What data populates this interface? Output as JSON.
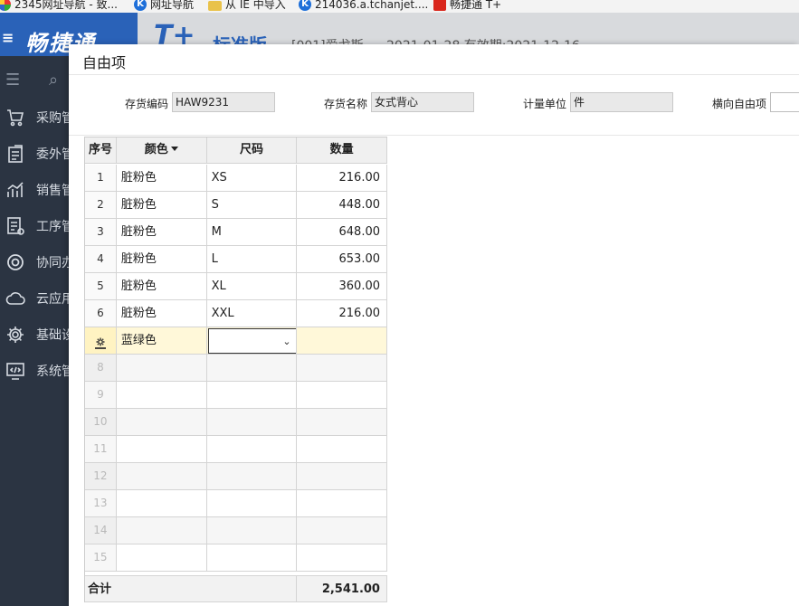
{
  "bookmarks": [
    {
      "label": "2345网址导航 - 致...",
      "icon": "multicolor-icon"
    },
    {
      "label": "网址导航",
      "icon": "k-icon"
    },
    {
      "label": "从 IE 中导入",
      "icon": "folder-icon"
    },
    {
      "label": "214036.a.tchanjet....",
      "icon": "k-icon"
    },
    {
      "label": "畅捷通 T+",
      "icon": "pdf-icon"
    }
  ],
  "header": {
    "logo": "畅捷通",
    "product": "T+",
    "edition": "标准版",
    "company": "[001]爱戈斯",
    "period": "2021-01-28   有效期:2021-12-16"
  },
  "sidebar": {
    "items": [
      {
        "label": "采购管理",
        "icon": "cart-icon"
      },
      {
        "label": "委外管理",
        "icon": "outsource-icon"
      },
      {
        "label": "销售管理",
        "icon": "sales-chart-icon"
      },
      {
        "label": "工序管理",
        "icon": "process-doc-icon"
      },
      {
        "label": "协同办公",
        "icon": "collab-icon"
      },
      {
        "label": "云应用",
        "icon": "cloud-icon"
      },
      {
        "label": "基础设置",
        "icon": "settings-icon"
      },
      {
        "label": "系统管理",
        "icon": "system-code-icon"
      }
    ]
  },
  "dialog": {
    "title": "自由项",
    "fields": {
      "code_label": "存货编码",
      "code_value": "HAW9231",
      "name_label": "存货名称",
      "name_value": "女式背心",
      "unit_label": "计量单位",
      "unit_value": "件",
      "horizontal_label": "横向自由项",
      "horizontal_value": ""
    },
    "grid": {
      "headers": [
        "序号",
        "颜色",
        "尺码",
        "数量"
      ],
      "rows": [
        {
          "no": "1",
          "color": "脏粉色",
          "size": "XS",
          "qty": "216.00"
        },
        {
          "no": "2",
          "color": "脏粉色",
          "size": "S",
          "qty": "448.00"
        },
        {
          "no": "3",
          "color": "脏粉色",
          "size": "M",
          "qty": "648.00"
        },
        {
          "no": "4",
          "color": "脏粉色",
          "size": "L",
          "qty": "653.00"
        },
        {
          "no": "5",
          "color": "脏粉色",
          "size": "XL",
          "qty": "360.00"
        },
        {
          "no": "6",
          "color": "脏粉色",
          "size": "XXL",
          "qty": "216.00"
        }
      ],
      "active_row": {
        "color": "蓝绿色",
        "size": "",
        "qty": ""
      },
      "empty_row_numbers": [
        "8",
        "9",
        "10",
        "11",
        "12",
        "13",
        "14",
        "15"
      ],
      "total_label": "合计",
      "total_value": "2,541.00"
    }
  }
}
